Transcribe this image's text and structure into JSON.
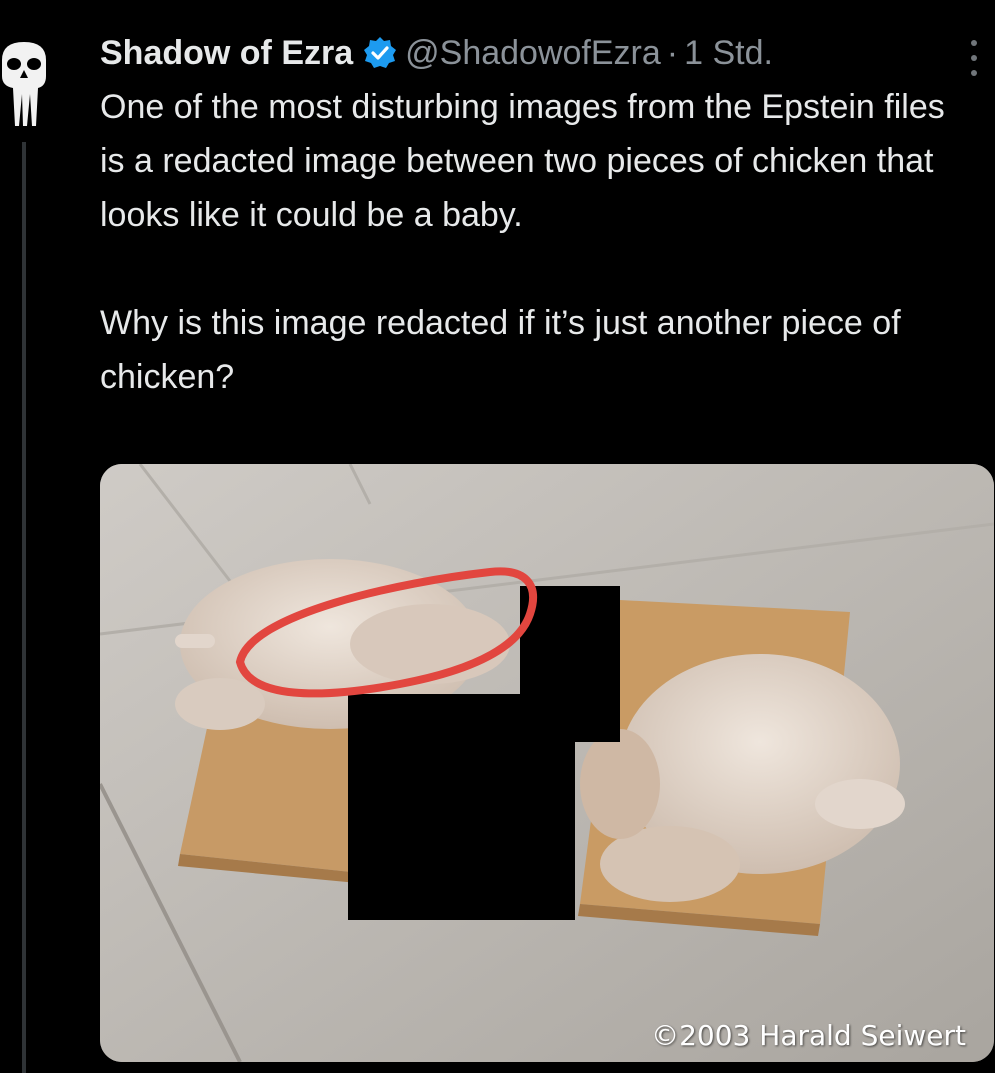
{
  "tweet": {
    "display_name": "Shadow of Ezra",
    "verified_icon": "verified-badge-icon",
    "handle": "@ShadowofEzra",
    "separator": "·",
    "time": "1 Std.",
    "paragraphs": [
      "One of the most disturbing images from the Epstein files is a redacted image between two pieces of chicken that looks like it could be a baby.",
      "Why is this image redacted if it’s just another piece of chicken?"
    ]
  },
  "media": {
    "credit": "©2003 Harald Seiwert"
  },
  "colors": {
    "background": "#000000",
    "text": "#e7e9ea",
    "muted": "#8b9299",
    "verified_blue": "#1d9bf0",
    "highlight_circle": "#e2463f"
  }
}
